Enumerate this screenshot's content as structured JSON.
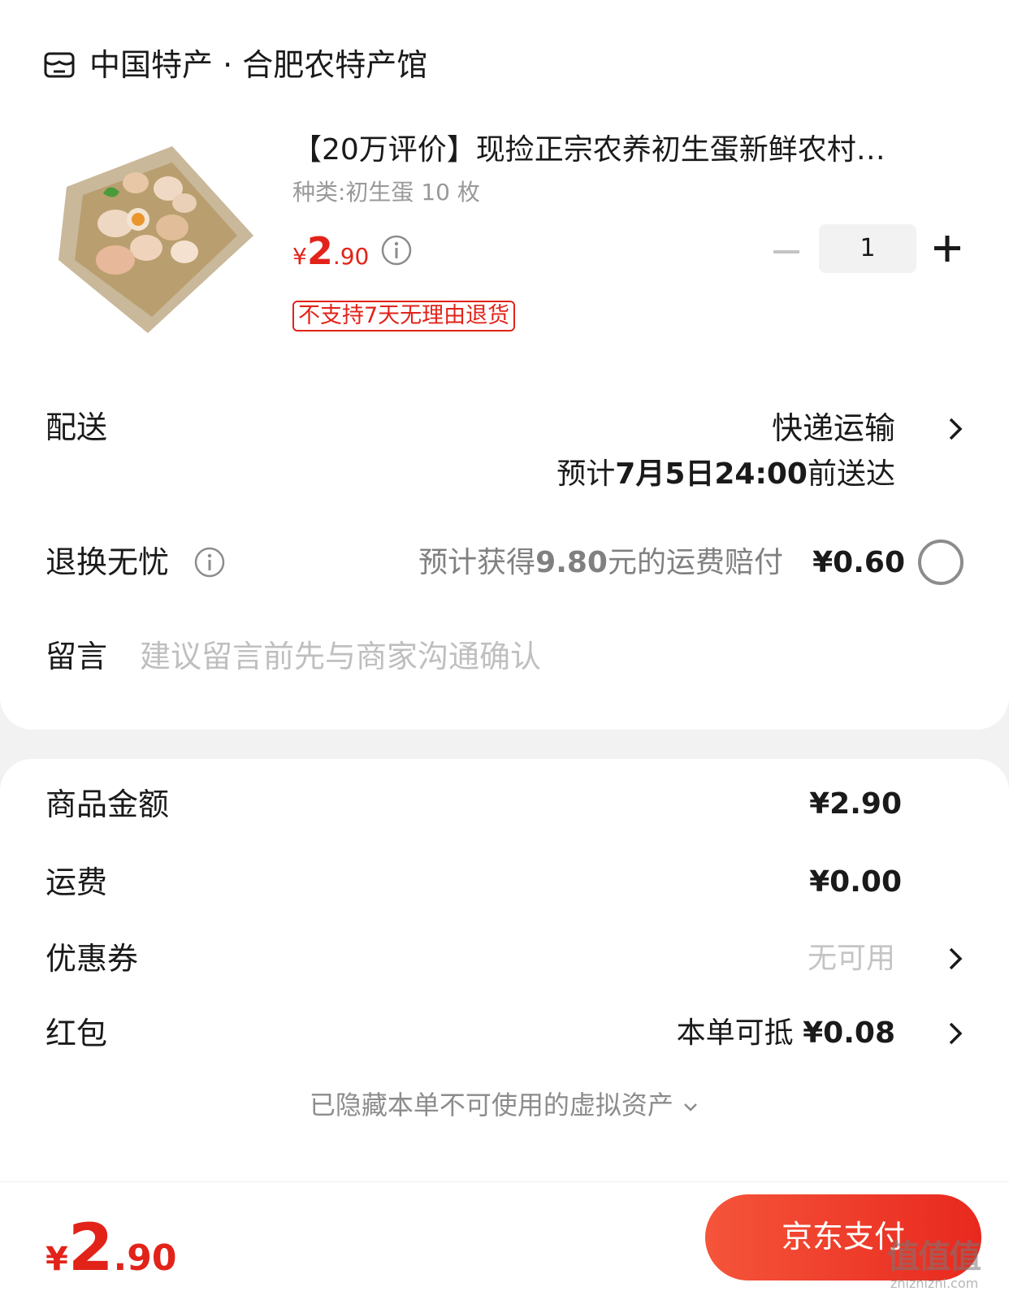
{
  "shop": {
    "name": "中国特产 · 合肥农特产馆",
    "icon": "shop-icon"
  },
  "product": {
    "title": "【20万评价】现捡正宗农养初生蛋新鲜农村…",
    "spec": "种类:初生蛋 10 枚",
    "price": {
      "currency": "¥",
      "int": "2",
      "dec": ".90"
    },
    "quantity": "1",
    "tag": "不支持7天无理由退货",
    "image_icon": "eggs-basket-image"
  },
  "delivery": {
    "label": "配送",
    "method": "快递运输",
    "eta_prefix": "预计",
    "eta_value": "7月5日24:00",
    "eta_suffix": "前送达"
  },
  "return_service": {
    "label": "退换无忧",
    "desc_prefix": "预计获得",
    "desc_value": "9.80",
    "desc_suffix": "元的运费赔付",
    "price": "¥0.60"
  },
  "message": {
    "label": "留言",
    "placeholder": "建议留言前先与商家沟通确认"
  },
  "summary": {
    "goods_amount_label": "商品金额",
    "goods_amount_value": "¥2.90",
    "shipping_label": "运费",
    "shipping_value": "¥0.00",
    "coupon_label": "优惠券",
    "coupon_value": "无可用",
    "red_packet_label": "红包",
    "red_packet_prefix": "本单可抵",
    "red_packet_value": "¥0.08",
    "hidden_assets": "已隐藏本单不可使用的虚拟资产"
  },
  "bottom": {
    "total": {
      "currency": "¥",
      "int": "2",
      "dec": ".90"
    },
    "pay_label": "京东支付"
  },
  "watermark": {
    "logo": "值值值",
    "url": "zhizhizhi.com"
  },
  "colors": {
    "accent": "#e2231a",
    "pay_gradient_start": "#f5553a",
    "pay_gradient_end": "#e8281e"
  }
}
